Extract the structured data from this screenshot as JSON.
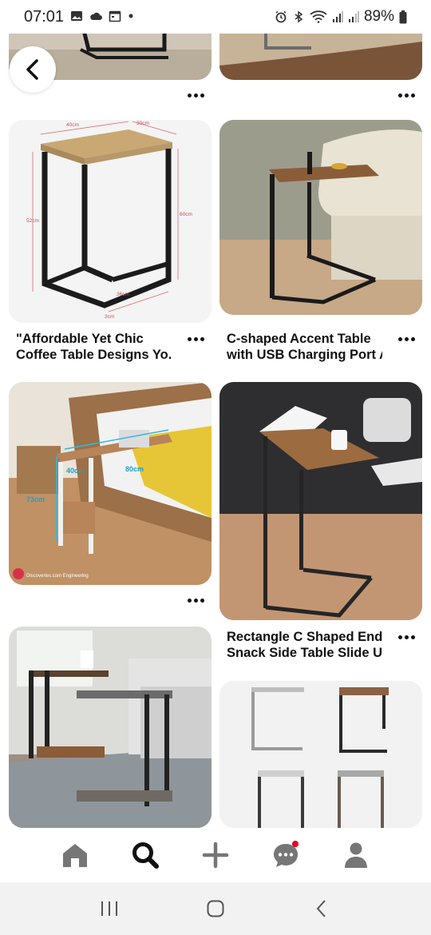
{
  "status_bar": {
    "time": "07:01",
    "battery": "89%",
    "icons": [
      "gallery-icon",
      "cloud-icon",
      "calendar-icon",
      "dot-icon",
      "alarm-icon",
      "bluetooth-icon",
      "wifi-icon",
      "signal-icon",
      "signal-icon",
      "battery-icon"
    ]
  },
  "feed": {
    "pins": [
      {
        "id": "pin-top-left",
        "caption": ""
      },
      {
        "id": "pin-top-right",
        "caption": ""
      },
      {
        "id": "pin-dimension-table",
        "caption_line1": "\"Affordable Yet Chic",
        "caption_line2": "Coffee Table Designs Yo...",
        "dims": [
          "40cm",
          "30cm",
          "52cm",
          "60cm",
          "36cm",
          "3cm"
        ]
      },
      {
        "id": "pin-accent-table",
        "caption_line1": "C-shaped Accent Table",
        "caption_line2": "with USB Charging Port A..."
      },
      {
        "id": "pin-bedside-table",
        "caption": "",
        "dims": [
          "73cm",
          "80cm",
          "40cm"
        ],
        "watermark": "Discoveries.com Engineering"
      },
      {
        "id": "pin-rectangle-table",
        "caption_line1": "Rectangle C Shaped End",
        "caption_line2": "Snack Side Table Slide U..."
      },
      {
        "id": "pin-living-room",
        "caption": ""
      },
      {
        "id": "pin-table-variants",
        "caption": ""
      }
    ]
  },
  "bottom_nav": {
    "items": [
      "home-icon",
      "search-icon",
      "plus-icon",
      "messages-icon",
      "profile-icon"
    ],
    "active": "search-icon"
  },
  "system_nav": {
    "items": [
      "recents-icon",
      "home-circle-icon",
      "back-chevron-icon"
    ]
  },
  "colors": {
    "accent": "#e60023",
    "icon": "#767676",
    "active": "#111111"
  }
}
